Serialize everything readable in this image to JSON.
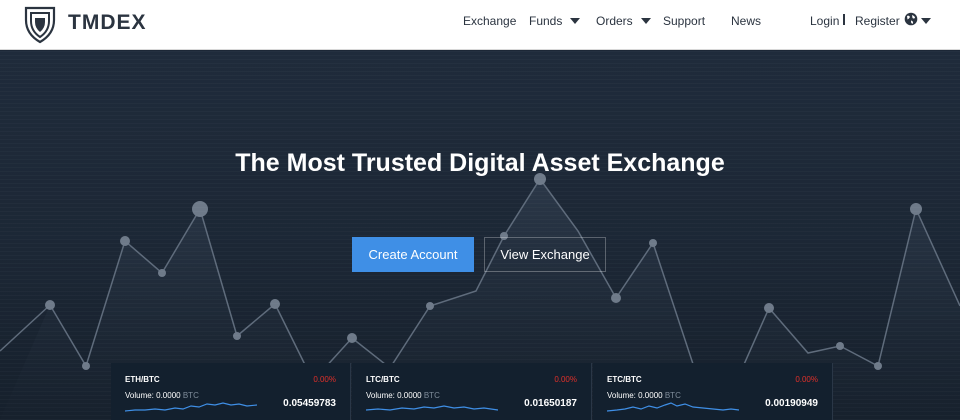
{
  "header": {
    "brand": "TMDEX",
    "nav": {
      "exchange": "Exchange",
      "funds": "Funds",
      "orders": "Orders",
      "support": "Support",
      "news": "News"
    },
    "login": "Login",
    "register": "Register",
    "icons": {
      "logo": "shield-logo",
      "language": "globe-icon",
      "dropdown": "caret-down-icon"
    }
  },
  "hero": {
    "title": "The Most Trusted Digital Asset Exchange",
    "create_account": "Create Account",
    "view_exchange": "View Exchange"
  },
  "tickers": [
    {
      "pair": "ETH/BTC",
      "change": "0.00%",
      "volume_label": "Volume: 0.0000",
      "volume_unit": "BTC",
      "price": "0.05459783"
    },
    {
      "pair": "LTC/BTC",
      "change": "0.00%",
      "volume_label": "Volume: 0.0000",
      "volume_unit": "BTC",
      "price": "0.01650187"
    },
    {
      "pair": "ETC/BTC",
      "change": "0.00%",
      "volume_label": "Volume: 0.0000",
      "volume_unit": "BTC",
      "price": "0.00190949"
    }
  ],
  "colors": {
    "primary_button": "#3f8fe6",
    "negative_change": "#e0302a",
    "sparkline": "#3f8fe6",
    "header_bg": "#ffffff",
    "hero_bg": "#1c2736"
  }
}
